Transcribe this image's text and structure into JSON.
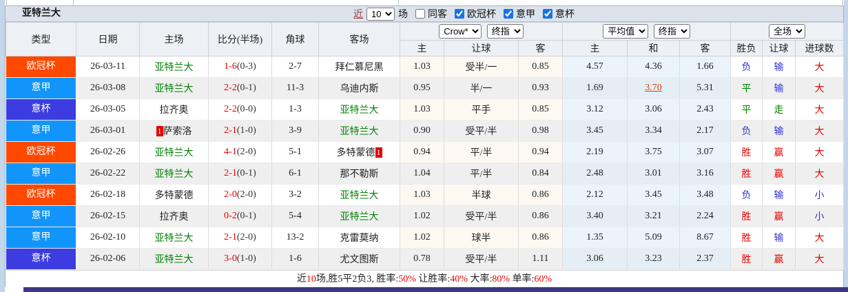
{
  "title_bar": {
    "team": "亚特兰大",
    "near_label": "近",
    "near_count": "10",
    "matches_label": "场",
    "same_opponent_label": "同客",
    "league_filters": [
      {
        "label": "欧冠杯",
        "checked": true
      },
      {
        "label": "意甲",
        "checked": true
      },
      {
        "label": "意杯",
        "checked": true
      }
    ]
  },
  "table": {
    "main_headers": [
      "类型",
      "日期",
      "主场",
      "比分(半场)",
      "角球",
      "客场"
    ],
    "group_dropdowns": {
      "bookmaker": "Crow*",
      "bookmaker_stage": "终指",
      "average": "平均值",
      "average_stage": "终指",
      "scope": "全场"
    },
    "sub_headers": [
      "主",
      "让球",
      "客",
      "主",
      "和",
      "客",
      "胜负",
      "让球",
      "进球数"
    ],
    "league_colors": {
      "欧冠杯": "#ff4800",
      "意甲": "#1295fb",
      "意杯": "#3c3ce0"
    },
    "focus_team_color": "#008000",
    "result_colors": {
      "red": "#e60000",
      "green": "#008000",
      "blue": "#3434d6"
    },
    "rows": [
      {
        "league": "欧冠杯",
        "date": "26-03-11",
        "home": {
          "name": "亚特兰大",
          "focus": true
        },
        "score_full": "1-6",
        "score_half": "(0-3)",
        "corners": "2-7",
        "away": {
          "name": "拜仁慕尼黑",
          "focus": false
        },
        "odds_home": "1.03",
        "handicap": "受半/一",
        "odds_away": "0.85",
        "avg_home": "4.57",
        "avg_draw": "4.36",
        "avg_away": "1.66",
        "avg_draw_highlighted": false,
        "result": {
          "outcome": {
            "text": "负",
            "color": "blue"
          },
          "handicap": {
            "text": "输",
            "color": "blue"
          },
          "goals": {
            "text": "大",
            "color": "red"
          }
        }
      },
      {
        "league": "意甲",
        "date": "26-03-08",
        "home": {
          "name": "亚特兰大",
          "focus": true
        },
        "score_full": "2-2",
        "score_half": "(0-1)",
        "corners": "11-3",
        "away": {
          "name": "乌迪内斯",
          "focus": false
        },
        "odds_home": "0.95",
        "handicap": "半/一",
        "odds_away": "0.93",
        "avg_home": "1.69",
        "avg_draw": "3.70",
        "avg_away": "5.31",
        "avg_draw_highlighted": true,
        "result": {
          "outcome": {
            "text": "平",
            "color": "green"
          },
          "handicap": {
            "text": "输",
            "color": "blue"
          },
          "goals": {
            "text": "大",
            "color": "red"
          }
        }
      },
      {
        "league": "意杯",
        "date": "26-03-05",
        "home": {
          "name": "拉齐奥",
          "focus": false
        },
        "score_full": "2-2",
        "score_half": "(0-0)",
        "corners": "1-3",
        "away": {
          "name": "亚特兰大",
          "focus": true
        },
        "odds_home": "1.03",
        "handicap": "平手",
        "odds_away": "0.85",
        "avg_home": "3.12",
        "avg_draw": "3.06",
        "avg_away": "2.43",
        "avg_draw_highlighted": false,
        "result": {
          "outcome": {
            "text": "平",
            "color": "green"
          },
          "handicap": {
            "text": "走",
            "color": "green"
          },
          "goals": {
            "text": "大",
            "color": "red"
          }
        }
      },
      {
        "league": "意甲",
        "date": "26-03-01",
        "home": {
          "name": "萨索洛",
          "focus": false,
          "rank": "1",
          "rank_pos": "before"
        },
        "score_full": "2-1",
        "score_half": "(1-0)",
        "corners": "3-9",
        "away": {
          "name": "亚特兰大",
          "focus": true
        },
        "odds_home": "0.90",
        "handicap": "受平/半",
        "odds_away": "0.98",
        "avg_home": "3.45",
        "avg_draw": "3.34",
        "avg_away": "2.17",
        "avg_draw_highlighted": false,
        "result": {
          "outcome": {
            "text": "负",
            "color": "blue"
          },
          "handicap": {
            "text": "输",
            "color": "blue"
          },
          "goals": {
            "text": "大",
            "color": "red"
          }
        }
      },
      {
        "league": "欧冠杯",
        "date": "26-02-26",
        "home": {
          "name": "亚特兰大",
          "focus": true
        },
        "score_full": "4-1",
        "score_half": "(2-0)",
        "corners": "5-1",
        "away": {
          "name": "多特蒙德",
          "focus": false,
          "rank": "1",
          "rank_pos": "after"
        },
        "odds_home": "0.94",
        "handicap": "平/半",
        "odds_away": "0.94",
        "avg_home": "2.19",
        "avg_draw": "3.75",
        "avg_away": "3.07",
        "avg_draw_highlighted": false,
        "result": {
          "outcome": {
            "text": "胜",
            "color": "red"
          },
          "handicap": {
            "text": "赢",
            "color": "red"
          },
          "goals": {
            "text": "大",
            "color": "red"
          }
        }
      },
      {
        "league": "意甲",
        "date": "26-02-22",
        "home": {
          "name": "亚特兰大",
          "focus": true
        },
        "score_full": "2-1",
        "score_half": "(0-1)",
        "corners": "6-1",
        "away": {
          "name": "那不勒斯",
          "focus": false
        },
        "odds_home": "1.04",
        "handicap": "平/半",
        "odds_away": "0.84",
        "avg_home": "2.48",
        "avg_draw": "3.01",
        "avg_away": "3.16",
        "avg_draw_highlighted": false,
        "result": {
          "outcome": {
            "text": "胜",
            "color": "red"
          },
          "handicap": {
            "text": "赢",
            "color": "red"
          },
          "goals": {
            "text": "大",
            "color": "red"
          }
        }
      },
      {
        "league": "欧冠杯",
        "date": "26-02-18",
        "home": {
          "name": "多特蒙德",
          "focus": false
        },
        "score_full": "2-0",
        "score_half": "(2-0)",
        "corners": "3-2",
        "away": {
          "name": "亚特兰大",
          "focus": true
        },
        "odds_home": "1.03",
        "handicap": "半球",
        "odds_away": "0.86",
        "avg_home": "2.12",
        "avg_draw": "3.45",
        "avg_away": "3.48",
        "avg_draw_highlighted": false,
        "result": {
          "outcome": {
            "text": "负",
            "color": "blue"
          },
          "handicap": {
            "text": "输",
            "color": "blue"
          },
          "goals": {
            "text": "小",
            "color": "blue"
          }
        }
      },
      {
        "league": "意甲",
        "date": "26-02-15",
        "home": {
          "name": "拉齐奥",
          "focus": false
        },
        "score_full": "0-2",
        "score_half": "(0-1)",
        "corners": "5-4",
        "away": {
          "name": "亚特兰大",
          "focus": true
        },
        "odds_home": "1.02",
        "handicap": "受平/半",
        "odds_away": "0.86",
        "avg_home": "3.40",
        "avg_draw": "3.21",
        "avg_away": "2.24",
        "avg_draw_highlighted": false,
        "result": {
          "outcome": {
            "text": "胜",
            "color": "red"
          },
          "handicap": {
            "text": "赢",
            "color": "red"
          },
          "goals": {
            "text": "小",
            "color": "blue"
          }
        }
      },
      {
        "league": "意甲",
        "date": "26-02-10",
        "home": {
          "name": "亚特兰大",
          "focus": true
        },
        "score_full": "2-1",
        "score_half": "(2-0)",
        "corners": "13-2",
        "away": {
          "name": "克雷莫纳",
          "focus": false
        },
        "odds_home": "1.02",
        "handicap": "球半",
        "odds_away": "0.86",
        "avg_home": "1.35",
        "avg_draw": "5.09",
        "avg_away": "8.67",
        "avg_draw_highlighted": false,
        "result": {
          "outcome": {
            "text": "胜",
            "color": "red"
          },
          "handicap": {
            "text": "输",
            "color": "blue"
          },
          "goals": {
            "text": "大",
            "color": "red"
          }
        }
      },
      {
        "league": "意杯",
        "date": "26-02-06",
        "home": {
          "name": "亚特兰大",
          "focus": true
        },
        "score_full": "3-0",
        "score_half": "(1-0)",
        "corners": "1-6",
        "away": {
          "name": "尤文图斯",
          "focus": false
        },
        "odds_home": "0.78",
        "handicap": "受平/半",
        "odds_away": "1.11",
        "avg_home": "3.06",
        "avg_draw": "3.23",
        "avg_away": "2.37",
        "avg_draw_highlighted": false,
        "result": {
          "outcome": {
            "text": "胜",
            "color": "red"
          },
          "handicap": {
            "text": "赢",
            "color": "red"
          },
          "goals": {
            "text": "大",
            "color": "red"
          }
        }
      }
    ]
  },
  "summary": {
    "segments": [
      {
        "t": "近",
        "c": "k"
      },
      {
        "t": "10",
        "c": "r"
      },
      {
        "t": "场,胜5平2负3, 胜率:",
        "c": "k"
      },
      {
        "t": "50%",
        "c": "r"
      },
      {
        "t": " 让胜率:",
        "c": "k"
      },
      {
        "t": "40%",
        "c": "r"
      },
      {
        "t": " 大率:",
        "c": "k"
      },
      {
        "t": "80%",
        "c": "r"
      },
      {
        "t": " 单率:",
        "c": "k"
      },
      {
        "t": "60%",
        "c": "r"
      }
    ]
  }
}
